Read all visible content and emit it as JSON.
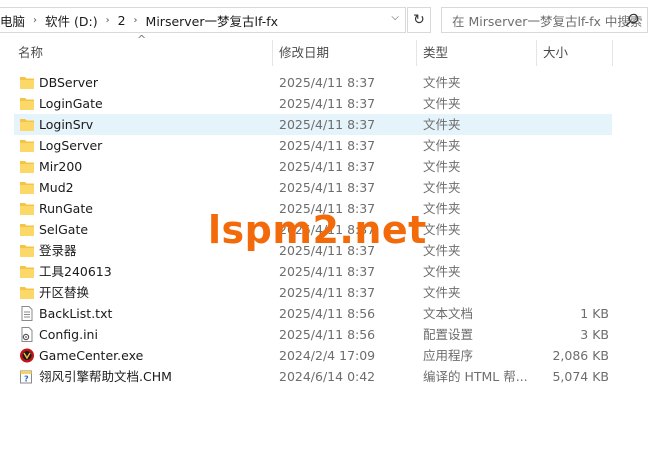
{
  "address": {
    "crumbs": [
      "电脑",
      "软件 (D:)",
      "2",
      "Mirserver一梦复古lf-fx"
    ],
    "search_placeholder": "在 Mirserver一梦复古lf-fx 中搜索"
  },
  "columns": {
    "name": "名称",
    "date": "修改日期",
    "type": "类型",
    "size": "大小"
  },
  "files": [
    {
      "name": "DBServer",
      "date": "2025/4/11 8:37",
      "type": "文件夹",
      "size": "",
      "icon": "folder-icon"
    },
    {
      "name": "LoginGate",
      "date": "2025/4/11 8:37",
      "type": "文件夹",
      "size": "",
      "icon": "folder-icon"
    },
    {
      "name": "LoginSrv",
      "date": "2025/4/11 8:37",
      "type": "文件夹",
      "size": "",
      "icon": "folder-icon"
    },
    {
      "name": "LogServer",
      "date": "2025/4/11 8:37",
      "type": "文件夹",
      "size": "",
      "icon": "folder-icon"
    },
    {
      "name": "Mir200",
      "date": "2025/4/11 8:37",
      "type": "文件夹",
      "size": "",
      "icon": "folder-icon"
    },
    {
      "name": "Mud2",
      "date": "2025/4/11 8:37",
      "type": "文件夹",
      "size": "",
      "icon": "folder-icon"
    },
    {
      "name": "RunGate",
      "date": "2025/4/11 8:37",
      "type": "文件夹",
      "size": "",
      "icon": "folder-icon"
    },
    {
      "name": "SelGate",
      "date": "2025/4/11 8:37",
      "type": "文件夹",
      "size": "",
      "icon": "folder-icon"
    },
    {
      "name": "登录器",
      "date": "2025/4/11 8:37",
      "type": "文件夹",
      "size": "",
      "icon": "folder-icon"
    },
    {
      "name": "工具240613",
      "date": "2025/4/11 8:37",
      "type": "文件夹",
      "size": "",
      "icon": "folder-icon"
    },
    {
      "name": "开区替换",
      "date": "2025/4/11 8:37",
      "type": "文件夹",
      "size": "",
      "icon": "folder-icon"
    },
    {
      "name": "BackList.txt",
      "date": "2025/4/11 8:56",
      "type": "文本文档",
      "size": "1 KB",
      "icon": "text-file-icon"
    },
    {
      "name": "Config.ini",
      "date": "2025/4/11 8:56",
      "type": "配置设置",
      "size": "3 KB",
      "icon": "config-file-icon"
    },
    {
      "name": "GameCenter.exe",
      "date": "2024/2/4 17:09",
      "type": "应用程序",
      "size": "2,086 KB",
      "icon": "app-exe-icon"
    },
    {
      "name": "翎风引擎帮助文档.CHM",
      "date": "2024/6/14 0:42",
      "type": "编译的 HTML 帮...",
      "size": "5,074 KB",
      "icon": "chm-help-icon"
    }
  ],
  "watermark": "lspm2.net",
  "colors": {
    "folder": "#f6c444",
    "selected_row": "#e5f3fb",
    "watermark": "#f26a0a",
    "exe_red": "#c0141b"
  }
}
